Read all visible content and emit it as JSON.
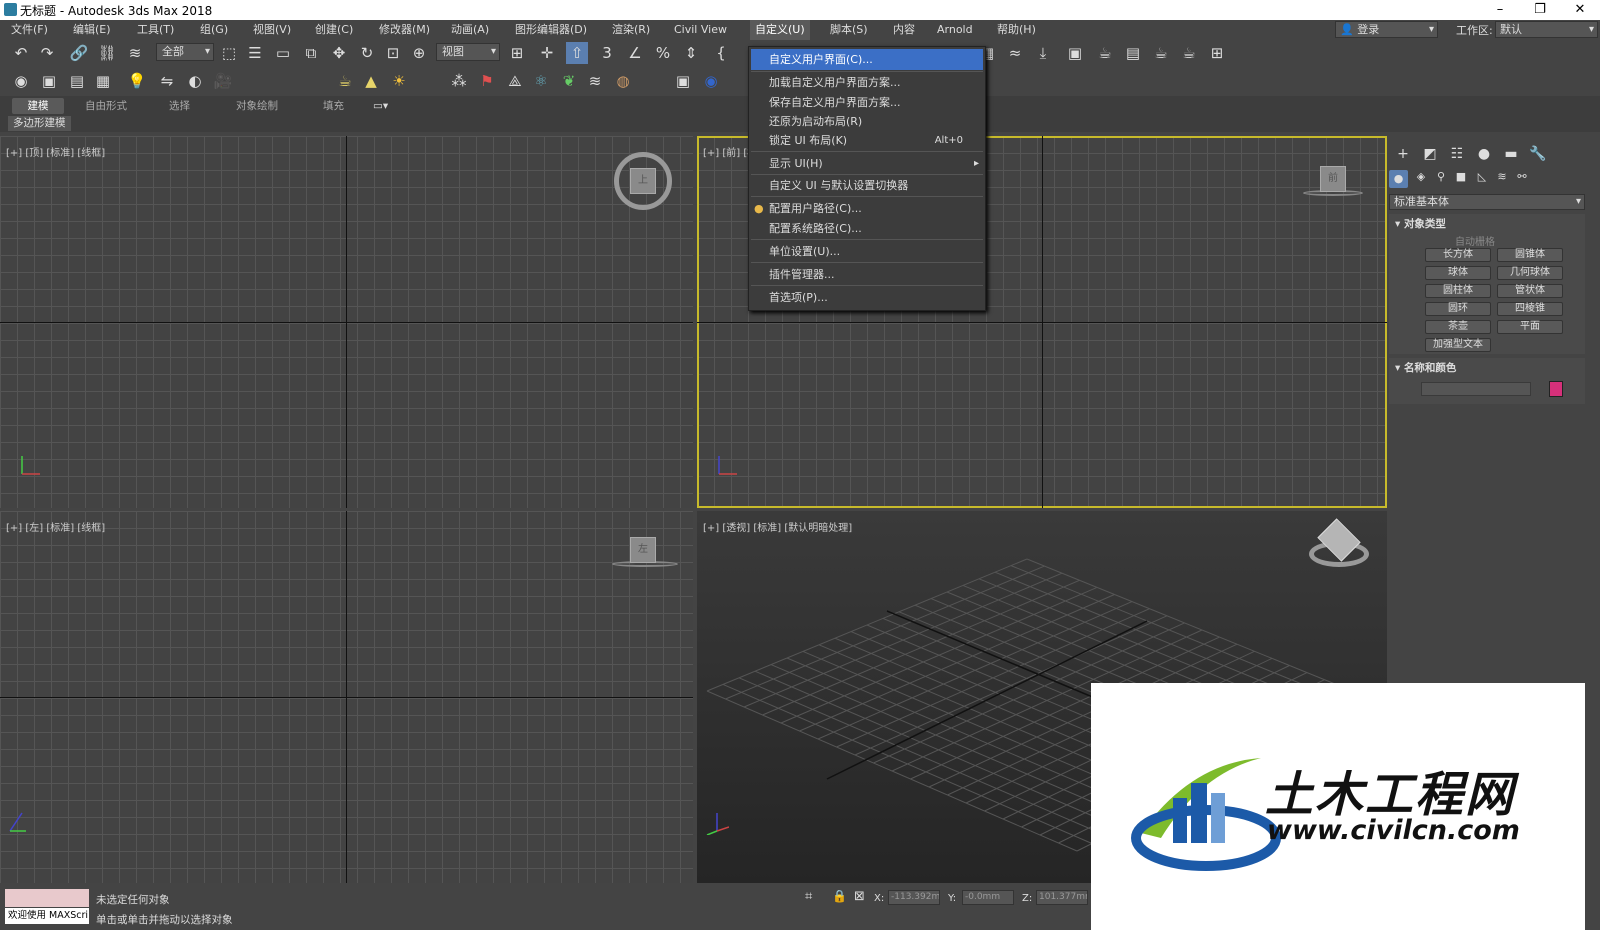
{
  "window": {
    "title": "无标题 - Autodesk 3ds Max 2018",
    "min": "–",
    "restore": "❐",
    "close": "✕"
  },
  "menubar": {
    "items": [
      "文件(F)",
      "编辑(E)",
      "工具(T)",
      "组(G)",
      "视图(V)",
      "创建(C)",
      "修改器(M)",
      "动画(A)",
      "图形编辑器(D)",
      "渲染(R)",
      "Civil View",
      "自定义(U)",
      "脚本(S)",
      "内容",
      "Arnold",
      "帮助(H)"
    ],
    "login": "登录",
    "workspace_label": "工作区:",
    "workspace_value": "默认"
  },
  "toolbar": {
    "selection_filter": "全部",
    "reference_coord": "视图"
  },
  "ribbon": {
    "tabs": [
      "建模",
      "自由形式",
      "选择",
      "对象绘制",
      "填充"
    ],
    "active_tab": "建模",
    "subtab": "多边形建模"
  },
  "viewports": {
    "top": {
      "label": "[+] [顶] [标准] [线框]",
      "cube_label": "上"
    },
    "front": {
      "label": "[+] [前] [标准] [线框]",
      "cube_label": "前"
    },
    "left": {
      "label": "[+] [左] [标准] [线框]",
      "cube_label": "左"
    },
    "perspective": {
      "label": "[+] [透视] [标准] [默认明暗处理]"
    }
  },
  "customize_menu": {
    "items": [
      {
        "label": "自定义用户界面(C)...",
        "shortcut": "",
        "highlighted": true
      },
      {
        "label": "加载自定义用户界面方案...",
        "shortcut": ""
      },
      {
        "label": "保存自定义用户界面方案...",
        "shortcut": ""
      },
      {
        "label": "还原为启动布局(R)",
        "shortcut": ""
      },
      {
        "label": "锁定 UI 布局(K)",
        "shortcut": "Alt+0"
      },
      {
        "label": "显示 UI(H)",
        "shortcut": "",
        "submenu": true
      },
      {
        "label": "自定义 UI 与默认设置切换器",
        "shortcut": ""
      },
      {
        "label": "配置用户路径(C)...",
        "shortcut": ""
      },
      {
        "label": "配置系统路径(C)...",
        "shortcut": ""
      },
      {
        "label": "单位设置(U)...",
        "shortcut": ""
      },
      {
        "label": "插件管理器...",
        "shortcut": ""
      },
      {
        "label": "首选项(P)...",
        "shortcut": ""
      }
    ]
  },
  "command_panel": {
    "category": "标准基本体",
    "object_type_header": "对象类型",
    "autogrid": "自动栅格",
    "buttons": [
      "长方体",
      "圆锥体",
      "球体",
      "几何球体",
      "圆柱体",
      "管状体",
      "圆环",
      "四棱锥",
      "茶壶",
      "平面",
      "加强型文本"
    ],
    "name_color_header": "名称和颜色",
    "object_color": "#d6307a"
  },
  "status": {
    "maxscript": "欢迎使用 MAXScri",
    "line1": "未选定任何对象",
    "line2": "单击或单击并拖动以选择对象",
    "x_label": "X:",
    "x_value": "-113.392m",
    "y_label": "Y:",
    "y_value": "-0.0mm",
    "z_label": "Z:",
    "z_value": "101.377mm"
  },
  "watermark": {
    "title": "土木工程网",
    "url": "www.civilcn.com"
  },
  "colors": {
    "accent": "#3b6fc6",
    "active_viewport": "#c7ba2b",
    "watermark_blue": "#1c5aa8",
    "watermark_green": "#7dbb2c"
  }
}
